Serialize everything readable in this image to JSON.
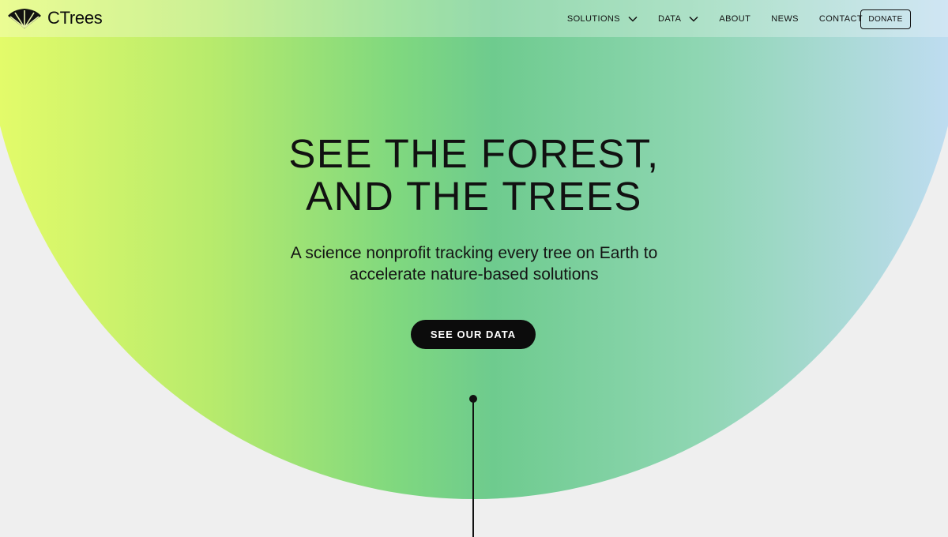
{
  "brand": {
    "name": "CTrees",
    "logo_icon": "leaf-fan-logo-icon"
  },
  "nav": {
    "items": [
      {
        "label": "SOLUTIONS",
        "has_dropdown": true
      },
      {
        "label": "DATA",
        "has_dropdown": true
      },
      {
        "label": "ABOUT",
        "has_dropdown": false
      },
      {
        "label": "NEWS",
        "has_dropdown": false
      },
      {
        "label": "CONTACT",
        "has_dropdown": false
      }
    ],
    "donate_label": "DONATE"
  },
  "hero": {
    "title_line1": "SEE THE FOREST,",
    "title_line2": "AND THE TREES",
    "subtitle_line1": "A science nonprofit tracking every tree on Earth to",
    "subtitle_line2": "accelerate nature-based solutions",
    "cta_label": "SEE OUR DATA"
  },
  "colors": {
    "gradient_start": "#e3fb6a",
    "gradient_mid": "#6ecb8e",
    "gradient_end": "#bedcf0",
    "page_background": "#efefef",
    "cta_background": "#0c0c0c"
  }
}
